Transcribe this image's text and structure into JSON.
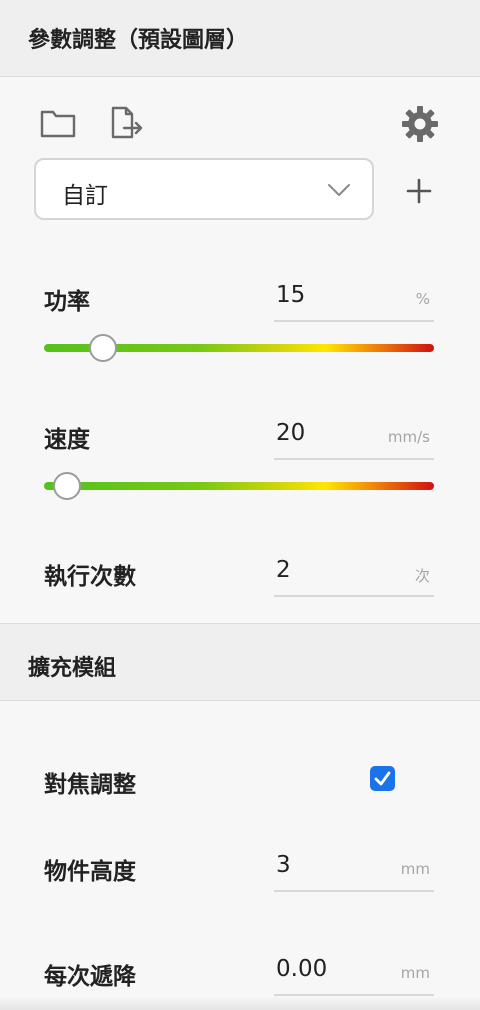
{
  "header": {
    "title": "參數調整（預設圖層）"
  },
  "toolbar": {
    "folder_icon": "folder-icon",
    "export_icon": "file-export-icon",
    "settings_icon": "gear-icon",
    "add_icon": "plus-icon"
  },
  "preset": {
    "selected": "自訂"
  },
  "params": {
    "power": {
      "label": "功率",
      "value": "15",
      "unit": "%",
      "level": 0.15
    },
    "speed": {
      "label": "速度",
      "value": "20",
      "unit": "mm/s",
      "level": 0.06
    },
    "repeat": {
      "label": "執行次數",
      "value": "2",
      "unit": "次"
    }
  },
  "addon": {
    "title": "擴充模組",
    "autofocus": {
      "label": "對焦調整",
      "checked": true
    },
    "object_height": {
      "label": "物件高度",
      "value": "3",
      "unit": "mm"
    },
    "z_step": {
      "label": "每次遞降",
      "value": "0.00",
      "unit": "mm"
    }
  },
  "colors": {
    "accent": "#1a73e8",
    "slider_start": "#54c11c",
    "slider_mid": "#ffe600",
    "slider_end": "#d01010"
  }
}
